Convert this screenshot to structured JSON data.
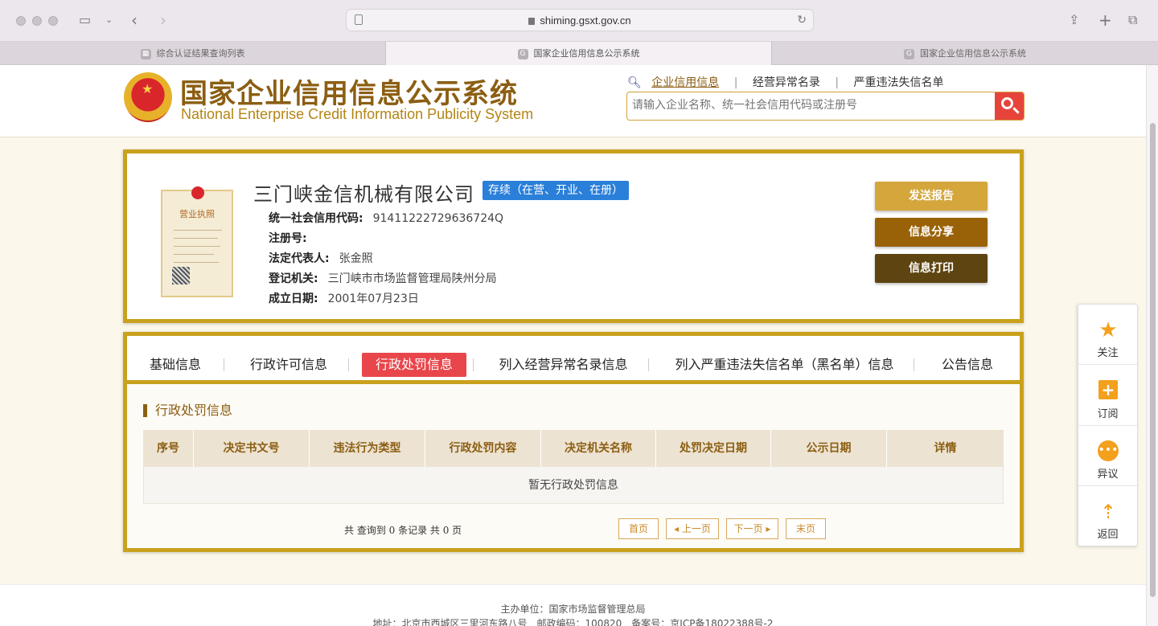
{
  "browser": {
    "url": "shiming.gsxt.gov.cn",
    "tabs": [
      {
        "label": "综合认证结果查询列表",
        "icon": "grid-icon"
      },
      {
        "label": "国家企业信用信息公示系统",
        "icon": "g-icon"
      },
      {
        "label": "国家企业信用信息公示系统",
        "icon": "g-icon"
      }
    ]
  },
  "header": {
    "title": "国家企业信用信息公示系统",
    "subtitle": "National Enterprise Credit Information Publicity System",
    "search_tabs": [
      "企业信用信息",
      "经营异常名录",
      "严重违法失信名单"
    ],
    "search_placeholder": "请输入企业名称、统一社会信用代码或注册号"
  },
  "company": {
    "name": "三门峡金信机械有限公司",
    "status": "存续（在营、开业、在册）",
    "license_title": "营业执照",
    "fields": [
      {
        "label": "统一社会信用代码:",
        "value": "91411222729636724Q"
      },
      {
        "label": "注册号:",
        "value": ""
      },
      {
        "label": "法定代表人:",
        "value": "张金照"
      },
      {
        "label": "登记机关:",
        "value": "三门峡市市场监督管理局陕州分局"
      },
      {
        "label": "成立日期:",
        "value": "2001年07月23日"
      }
    ],
    "actions": [
      "发送报告",
      "信息分享",
      "信息打印"
    ]
  },
  "detail": {
    "tabs": [
      "基础信息",
      "行政许可信息",
      "行政处罚信息",
      "列入经营异常名录信息",
      "列入严重违法失信名单（黑名单）信息",
      "公告信息"
    ],
    "active_tab": "行政处罚信息",
    "section_title": "行政处罚信息",
    "columns": [
      "序号",
      "决定书文号",
      "违法行为类型",
      "行政处罚内容",
      "决定机关名称",
      "处罚决定日期",
      "公示日期",
      "详情"
    ],
    "empty_text": "暂无行政处罚信息",
    "pager_info": "共 查询到 0 条记录 共 0 页",
    "pager_buttons": [
      "首页",
      "◂ 上一页",
      "下一页 ▸",
      "末页"
    ]
  },
  "sidebar": {
    "items": [
      {
        "label": "关注",
        "icon": "star-icon"
      },
      {
        "label": "订阅",
        "icon": "subscribe-icon"
      },
      {
        "label": "异议",
        "icon": "chat-icon"
      },
      {
        "label": "返回",
        "icon": "back-to-top-icon"
      }
    ]
  },
  "footer": {
    "line1": "主办单位：国家市场监督管理总局",
    "line2": "地址：北京市西城区三里河东路八号　邮政编码：100820　备案号：京ICP备18022388号-2"
  },
  "colors": {
    "gold": "#c9a11d",
    "brown": "#8b5e12",
    "active_tab": "#e8464b",
    "status_badge": "#2a7fd9",
    "btn_send": "#d4a63c",
    "btn_share": "#9a6208",
    "btn_print": "#5e4410"
  }
}
